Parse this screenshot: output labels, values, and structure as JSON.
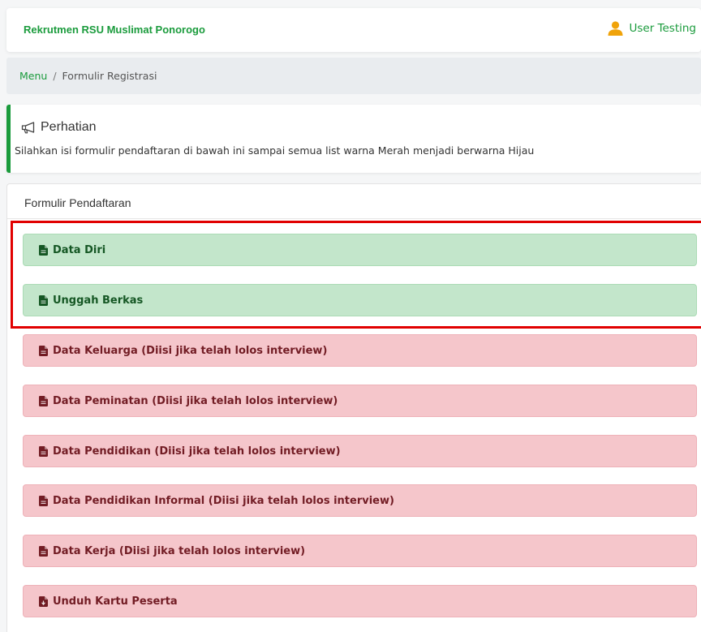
{
  "navbar": {
    "brand": "Rekrutmen RSU Muslimat Ponorogo",
    "user_name": "User Testing",
    "user_icon": "user-icon"
  },
  "breadcrumb": {
    "link": "Menu",
    "separator": "/",
    "current": "Formulir Registrasi"
  },
  "callout": {
    "icon": "megaphone-icon",
    "title": "Perhatian",
    "text": "Silahkan isi formulir pendaftaran di bawah ini sampai semua list warna Merah menjadi berwarna Hijau"
  },
  "form": {
    "header": "Formulir Pendaftaran",
    "items": [
      {
        "label": "Data Diri",
        "status": "complete",
        "icon": "file-icon"
      },
      {
        "label": "Unggah Berkas",
        "status": "complete",
        "icon": "file-icon"
      },
      {
        "label": "Data Keluarga (Diisi jika telah lolos interview)",
        "status": "incomplete",
        "icon": "file-icon"
      },
      {
        "label": "Data Peminatan (Diisi jika telah lolos interview)",
        "status": "incomplete",
        "icon": "file-icon"
      },
      {
        "label": "Data Pendidikan (Diisi jika telah lolos interview)",
        "status": "incomplete",
        "icon": "file-icon"
      },
      {
        "label": "Data Pendidikan Informal (Diisi jika telah lolos interview)",
        "status": "incomplete",
        "icon": "file-icon"
      },
      {
        "label": "Data Kerja (Diisi jika telah lolos interview)",
        "status": "incomplete",
        "icon": "file-icon"
      },
      {
        "label": "Unduh Kartu Peserta",
        "status": "incomplete",
        "icon": "file-download-icon"
      }
    ]
  },
  "colors": {
    "brand_green": "#1a9b3c",
    "complete_bg": "#c3e6cb",
    "complete_text": "#155724",
    "incomplete_bg": "#f5c6cb",
    "incomplete_text": "#721c24",
    "highlight": "#e10000"
  }
}
